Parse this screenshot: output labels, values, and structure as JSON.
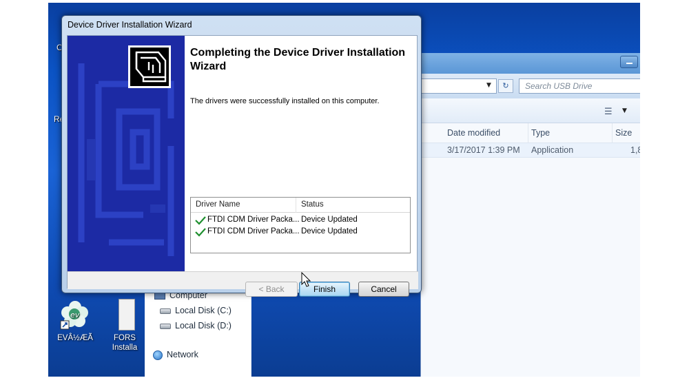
{
  "desktop": {
    "left_edge_letters": [
      "C",
      "Re"
    ],
    "icons": [
      {
        "label": "EVÂ½ÆÃ"
      },
      {
        "label_lines": [
          "FORS",
          "Installa"
        ]
      }
    ]
  },
  "explorer": {
    "search_placeholder": "Search USB Drive",
    "columns": [
      "Date modified",
      "Type",
      "Size"
    ],
    "row": {
      "date_modified": "3/17/2017 1:39 PM",
      "type": "Application",
      "size": "1,8"
    },
    "nav": {
      "computer": "Computer",
      "drives": [
        "Local Disk (C:)",
        "Local Disk (D:)"
      ],
      "network": "Network"
    }
  },
  "dialog": {
    "title": "Device Driver Installation Wizard",
    "heading": "Completing the Device Driver Installation Wizard",
    "message": "The drivers were successfully installed on this computer.",
    "table": {
      "headers": [
        "Driver Name",
        "Status"
      ],
      "rows": [
        {
          "name": "FTDI CDM Driver Packa...",
          "status": "Device Updated"
        },
        {
          "name": "FTDI CDM Driver Packa...",
          "status": "Device Updated"
        }
      ]
    },
    "buttons": {
      "back": "< Back",
      "finish": "Finish",
      "cancel": "Cancel"
    },
    "colors": {
      "banner": "#1c2aa4",
      "check": "#1e8f2e"
    }
  }
}
